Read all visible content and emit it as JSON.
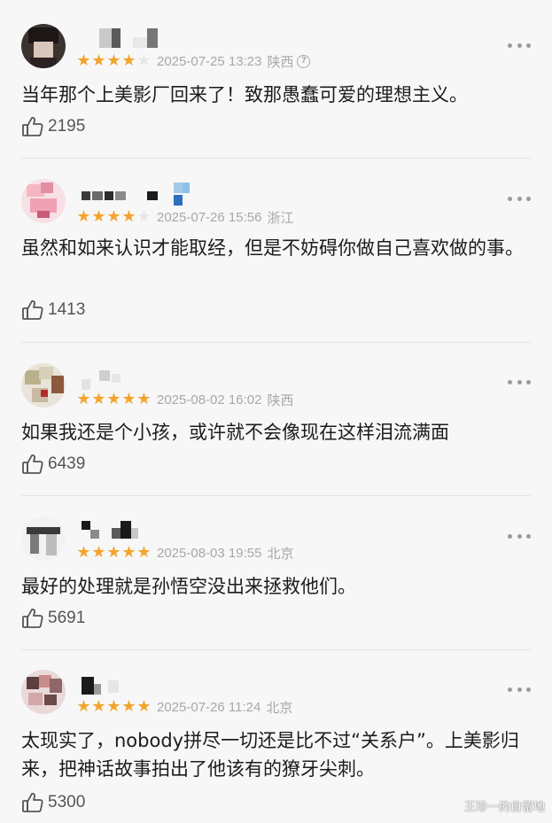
{
  "comments": [
    {
      "rating": 4,
      "date": "2025-07-25 13:23",
      "region": "陕西",
      "text": "当年那个上美影厂回来了！致那愚蠢可爱的理想主义。",
      "likes": "2195",
      "show_info_icon": true
    },
    {
      "rating": 4,
      "date": "2025-07-26 15:56",
      "region": "浙江",
      "text": "虽然和如来认识才能取经，但是不妨碍你做自己喜欢做的事。",
      "likes": "1413"
    },
    {
      "rating": 5,
      "date": "2025-08-02 16:02",
      "region": "陕西",
      "text": "如果我还是个小孩，或许就不会像现在这样泪流满面",
      "likes": "6439"
    },
    {
      "rating": 5,
      "date": "2025-08-03 19:55",
      "region": "北京",
      "text": "最好的处理就是孙悟空没出来拯救他们。",
      "likes": "5691"
    },
    {
      "rating": 5,
      "date": "2025-07-26 11:24",
      "region": "北京",
      "text": "太现实了，nobody拼尽一切还是比不过“关系户”。上美影归来，把神话故事拍出了他该有的獠牙尖刺。",
      "likes": "5300"
    }
  ],
  "watermark": "王珍一的自留地",
  "colors": {
    "star": "#f2a42c",
    "star_empty": "#e6e6e6",
    "meta_text": "#a8a8a8",
    "background": "#f7f7f7"
  },
  "icons": {
    "like": "thumbs-up-icon",
    "more": "more-dots-icon",
    "info": "info-circle-icon"
  }
}
